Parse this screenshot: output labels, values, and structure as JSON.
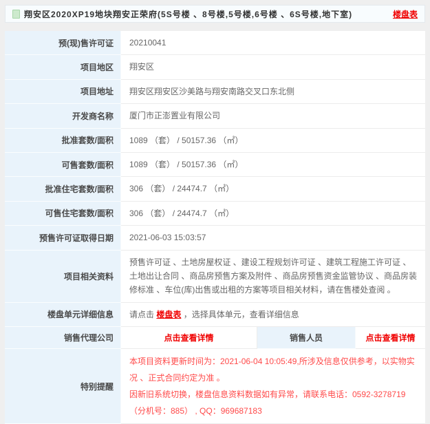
{
  "header": {
    "title": "翔安区2020XP19地块翔安正荣府(5S号楼 、8号楼,5号楼,6号楼 、6S号楼,地下室)",
    "link_label": "楼盘表"
  },
  "table": {
    "rows": [
      {
        "label": "预(现)售许可证",
        "value": "20210041"
      },
      {
        "label": "项目地区",
        "value": "翔安区"
      },
      {
        "label": "项目地址",
        "value": "翔安区翔安区沙美路与翔安南路交叉口东北侧"
      },
      {
        "label": "开发商名称",
        "value": "厦门市正澎置业有限公司"
      },
      {
        "label": "批准套数/面积",
        "value": "1089 （套）  / 50157.36 （㎡）"
      },
      {
        "label": "可售套数/面积",
        "value": "1089 （套）  / 50157.36 （㎡）"
      },
      {
        "label": "批准住宅套数/面积",
        "value": "306 （套）  / 24474.7 （㎡）"
      },
      {
        "label": "可售住宅套数/面积",
        "value": "306 （套）  / 24474.7 （㎡）"
      },
      {
        "label": "预售许可证取得日期",
        "value": "2021-06-03 15:03:57"
      }
    ],
    "related_docs": {
      "label": "项目相关资料",
      "value": "预售许可证 、土地房屋权证 、建设工程规划许可证 、建筑工程施工许可证 、土地出让合同 、商品房预售方案及附件 、商品房预售资金监管协议 、商品房装修标准 、车位(库)出售或出租的方案等项目相关材料，请在售楼处查阅 。"
    },
    "unit_info": {
      "label": "楼盘单元详细信息",
      "prefix": "请点击 ",
      "link": "楼盘表",
      "suffix": " ，选择具体单元，查看详细信息"
    },
    "agency": {
      "label": "销售代理公司",
      "detail1": "点击查看详情",
      "staff_label": "销售人员",
      "detail2": "点击查看详情"
    },
    "notice": {
      "label": "特别提醒",
      "line1": "本项目资料更新时间为：2021-06-04 10:05:49,所涉及信息仅供参考，以实物实况 、正式合同约定为准 。",
      "line2": "因新旧系统切换，楼盘信息资料数据如有异常，请联系电话：0592-3278719 （分机号：885） , QQ：969687183"
    }
  },
  "colors": {
    "accent_red": "#f00000",
    "notice_red": "#ff4a4a",
    "label_bg": "#e9f3fb",
    "page_bg": "#efefef"
  }
}
